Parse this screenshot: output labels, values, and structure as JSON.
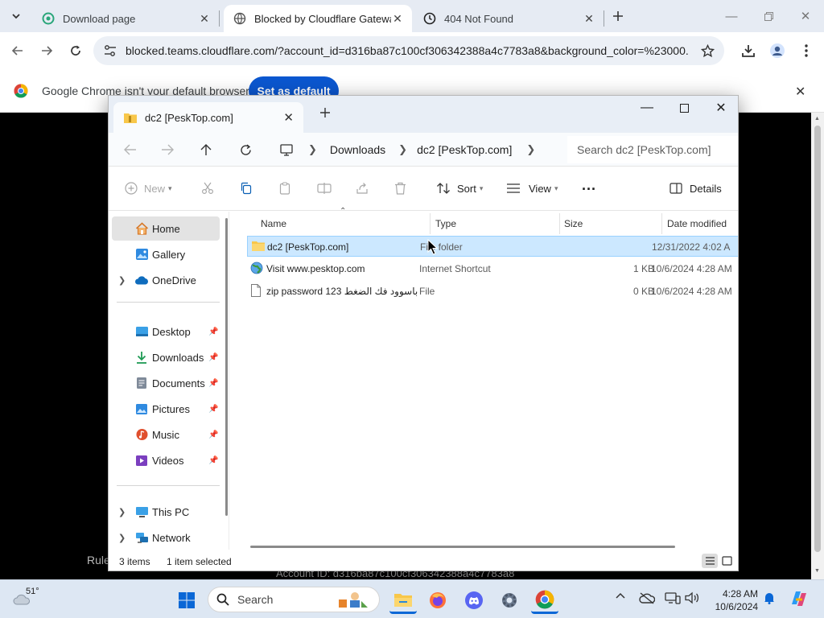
{
  "browser": {
    "tabs": [
      {
        "label": "Download page",
        "active": false
      },
      {
        "label": "Blocked by Cloudflare Gateway",
        "active": true
      },
      {
        "label": "404 Not Found",
        "active": false
      }
    ],
    "url": "blocked.teams.cloudflare.com/?account_id=d316ba87c100cf306342388a4c7783a8&background_color=%23000...",
    "infobar": {
      "message": "Google Chrome isn't your default browser",
      "button": "Set as default"
    },
    "page": {
      "partial_left_text": "Rule",
      "account_text": "Account ID: d316ba87c100cf306342388a4c7783a8"
    }
  },
  "explorer": {
    "tab_title": "dc2 [PeskTop.com]",
    "breadcrumb": [
      "Downloads",
      "dc2 [PeskTop.com]"
    ],
    "search_placeholder": "Search dc2 [PeskTop.com]",
    "commands": {
      "new": "New",
      "sort": "Sort",
      "view": "View",
      "more": "...",
      "details": "Details"
    },
    "sidebar": {
      "top": [
        {
          "label": "Home",
          "icon": "home-icon",
          "selected": true
        },
        {
          "label": "Gallery",
          "icon": "gallery-icon"
        },
        {
          "label": "OneDrive",
          "icon": "cloud-icon",
          "expandable": true
        }
      ],
      "quick_access": [
        {
          "label": "Desktop",
          "icon": "desktop-icon"
        },
        {
          "label": "Downloads",
          "icon": "download-icon"
        },
        {
          "label": "Documents",
          "icon": "documents-icon"
        },
        {
          "label": "Pictures",
          "icon": "pictures-icon"
        },
        {
          "label": "Music",
          "icon": "music-icon"
        },
        {
          "label": "Videos",
          "icon": "videos-icon"
        }
      ],
      "bottom": [
        {
          "label": "This PC",
          "icon": "computer-icon"
        },
        {
          "label": "Network",
          "icon": "network-icon"
        }
      ]
    },
    "columns": [
      "Name",
      "Type",
      "Size",
      "Date modified"
    ],
    "files": [
      {
        "name": "dc2 [PeskTop.com]",
        "type": "File folder",
        "size": "",
        "date": "12/31/2022 4:02 A",
        "icon": "folder-icon",
        "selected": true
      },
      {
        "name": "Visit www.pesktop.com",
        "type": "Internet Shortcut",
        "size": "1 KB",
        "date": "10/6/2024 4:28 AM",
        "icon": "globe-icon"
      },
      {
        "name": "zip password 123 باسوود فك الضغط",
        "type": "File",
        "size": "0 KB",
        "date": "10/6/2024 4:28 AM",
        "icon": "file-icon"
      }
    ],
    "status": {
      "count": "3 items",
      "selection": "1 item selected"
    }
  },
  "taskbar": {
    "weather": "51°",
    "search": "Search",
    "time": "4:28 AM",
    "date": "10/6/2024"
  },
  "colors": {
    "chrome_accent": "#0b57d0",
    "selection_bg": "#cce8ff",
    "folder": "#f8c74a"
  }
}
